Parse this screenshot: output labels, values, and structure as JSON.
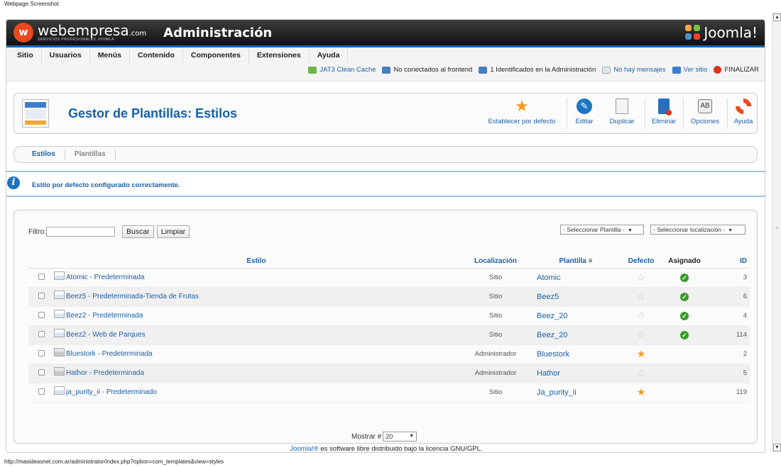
{
  "caption": "Webpage Screenshot",
  "status_url": "http://masideasnet.com.ar/administrator/index.php?option=com_templates&view=styles",
  "header": {
    "brand_name": "webempresa",
    "brand_tld": ".com",
    "brand_sub": "SERVICIOS PROFESIONALES JOOMLA",
    "app_title": "Administración",
    "joomla_logo": "Joomla!"
  },
  "menu": [
    "Sitio",
    "Usuarios",
    "Menús",
    "Contenido",
    "Componentes",
    "Extensiones",
    "Ayuda"
  ],
  "statusline": {
    "cache": "JAT3 Clean Cache",
    "frontend": "No conectados al frontend",
    "admin": "1 Identificados en la Administración",
    "messages": "No hay mensajes",
    "view_site": "Ver sitio",
    "logout": "FINALIZAR"
  },
  "toolbar": {
    "title": "Gestor de Plantillas: Estilos",
    "default": "Establecer por defecto",
    "edit": "Editar",
    "duplicate": "Duplicar",
    "delete": "Eliminar",
    "options": "Opciones",
    "help": "Ayuda"
  },
  "subnav": {
    "styles": "Estilos",
    "templates": "Plantillas"
  },
  "message": "Estilo por defecto configurado correctamente.",
  "filter": {
    "label": "Filtro:",
    "value": "",
    "search_btn": "Buscar",
    "clear_btn": "Limpiar",
    "template_select": "- Seleccionar Plantilla -",
    "location_select": "- Seleccionar localización -"
  },
  "table": {
    "headers": {
      "style": "Estilo",
      "location": "Localización",
      "template": "Plantilla",
      "default": "Defecto",
      "assigned": "Asignado",
      "id": "ID"
    },
    "rows": [
      {
        "name": "Atomic - Predeterminada",
        "location": "Sitio",
        "template": "Atomic",
        "default": false,
        "assigned": true,
        "id": "3",
        "admin": false
      },
      {
        "name": "Beez5 - Predeterminada-Tienda de Frutas",
        "location": "Sitio",
        "template": "Beez5",
        "default": false,
        "assigned": true,
        "id": "6",
        "admin": false
      },
      {
        "name": "Beez2 - Predeterminada",
        "location": "Sitio",
        "template": "Beez_20",
        "default": false,
        "assigned": true,
        "id": "4",
        "admin": false
      },
      {
        "name": "Beez2 - Web de Parques",
        "location": "Sitio",
        "template": "Beez_20",
        "default": false,
        "assigned": true,
        "id": "114",
        "admin": false
      },
      {
        "name": "Bluestork - Predeterminada",
        "location": "Administrador",
        "template": "Bluestork",
        "default": true,
        "assigned": false,
        "id": "2",
        "admin": true
      },
      {
        "name": "Hathor - Predeterminada",
        "location": "Administrador",
        "template": "Hathor",
        "default": false,
        "assigned": false,
        "id": "5",
        "admin": true
      },
      {
        "name": "ja_purity_ii - Predeterminado",
        "location": "Sitio",
        "template": "Ja_purity_ii",
        "default": true,
        "assigned": false,
        "id": "119",
        "admin": false
      }
    ]
  },
  "pager": {
    "label": "Mostrar #",
    "value": "20"
  },
  "footer": {
    "link": "Joomla!®",
    "text": " es software libre distribuido bajo la licencia GNU/GPL."
  }
}
